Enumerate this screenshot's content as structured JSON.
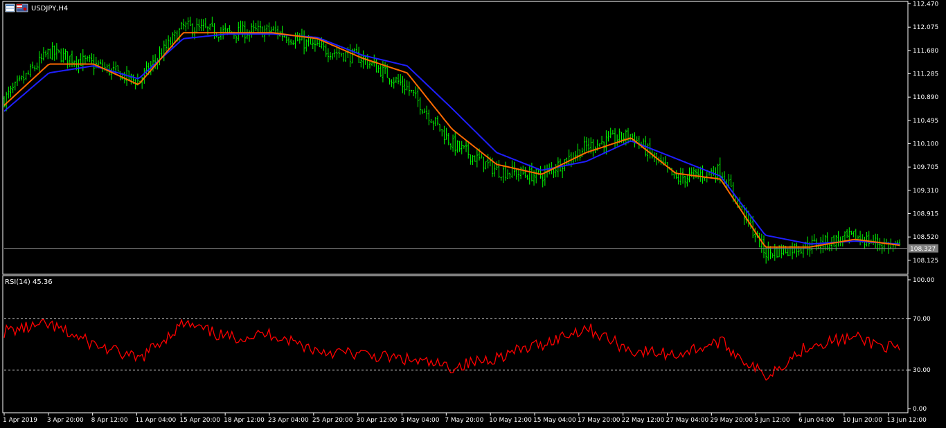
{
  "window": {
    "title": "USDJPY,H4",
    "icons": [
      "chart-window-icon",
      "us-japan-flag-icon"
    ]
  },
  "colors": {
    "background": "#000000",
    "frame": "#ffffff",
    "candle_up": "#00ff00",
    "ma_fast": "#ff6a00",
    "ma_slow": "#1f1fff",
    "rsi": "#ff0000",
    "price_line": "#808080",
    "price_label_bg": "#808080"
  },
  "price_axis": {
    "ticks": [
      "112.470",
      "112.075",
      "111.680",
      "111.285",
      "110.890",
      "110.495",
      "110.100",
      "109.705",
      "109.310",
      "108.915",
      "108.520",
      "108.125"
    ],
    "current_price": "108.327"
  },
  "rsi_axis": {
    "label": "RSI(14) 45.36",
    "ticks": [
      "100.00",
      "70.00",
      "30.00",
      "0.00"
    ],
    "levels": [
      70,
      30
    ]
  },
  "time_axis": {
    "labels": [
      "1 Apr 2019",
      "3 Apr 20:00",
      "8 Apr 12:00",
      "11 Apr 04:00",
      "15 Apr 20:00",
      "18 Apr 12:00",
      "23 Apr 04:00",
      "25 Apr 20:00",
      "30 Apr 12:00",
      "3 May 04:00",
      "7 May 20:00",
      "10 May 12:00",
      "15 May 04:00",
      "17 May 20:00",
      "22 May 12:00",
      "27 May 04:00",
      "29 May 20:00",
      "3 Jun 12:00",
      "6 Jun 04:00",
      "10 Jun 20:00",
      "13 Jun 12:00"
    ]
  },
  "chart_data": [
    {
      "type": "line",
      "series_kind": "candlestick-approximation",
      "symbol": "USDJPY",
      "timeframe": "H4",
      "ylim": [
        107.9,
        112.5
      ],
      "x": [
        "1 Apr 2019",
        "3 Apr 20:00",
        "8 Apr 12:00",
        "11 Apr 04:00",
        "15 Apr 20:00",
        "18 Apr 12:00",
        "23 Apr 04:00",
        "25 Apr 20:00",
        "30 Apr 12:00",
        "3 May 04:00",
        "7 May 20:00",
        "10 May 12:00",
        "15 May 04:00",
        "17 May 20:00",
        "22 May 12:00",
        "27 May 04:00",
        "29 May 20:00",
        "3 Jun 12:00",
        "6 Jun 04:00",
        "10 Jun 20:00",
        "13 Jun 12:00"
      ],
      "series": [
        {
          "name": "",
          "values": [
            110.85,
            111.65,
            111.45,
            111.15,
            112.08,
            111.98,
            112.02,
            111.72,
            111.55,
            111.05,
            110.1,
            109.65,
            109.55,
            110.05,
            110.25,
            109.5,
            109.65,
            108.25,
            108.38,
            108.52,
            108.33
          ]
        },
        {
          "name": "",
          "values": [
            110.75,
            111.45,
            111.45,
            111.1,
            111.98,
            111.98,
            111.98,
            111.88,
            111.55,
            111.3,
            110.35,
            109.75,
            109.58,
            109.95,
            110.2,
            109.6,
            109.5,
            108.35,
            108.35,
            108.48,
            108.38
          ]
        },
        {
          "name": "",
          "values": [
            110.65,
            111.3,
            111.42,
            111.2,
            111.88,
            111.96,
            111.96,
            111.9,
            111.6,
            111.42,
            110.7,
            109.95,
            109.65,
            109.8,
            110.15,
            109.85,
            109.55,
            108.55,
            108.4,
            108.45,
            108.4
          ]
        }
      ]
    },
    {
      "type": "line",
      "title": "RSI(14) 45.36",
      "ylim": [
        0,
        100
      ],
      "levels": [
        70,
        30
      ],
      "x": [
        "1 Apr 2019",
        "3 Apr 20:00",
        "8 Apr 12:00",
        "11 Apr 04:00",
        "15 Apr 20:00",
        "18 Apr 12:00",
        "23 Apr 04:00",
        "25 Apr 20:00",
        "30 Apr 12:00",
        "3 May 04:00",
        "7 May 20:00",
        "10 May 12:00",
        "15 May 04:00",
        "17 May 20:00",
        "22 May 12:00",
        "27 May 04:00",
        "29 May 20:00",
        "3 Jun 12:00",
        "6 Jun 04:00",
        "10 Jun 20:00",
        "13 Jun 12:00"
      ],
      "series": [
        {
          "name": "",
          "values": [
            60,
            65,
            50,
            38,
            66,
            55,
            58,
            45,
            42,
            38,
            32,
            40,
            50,
            63,
            45,
            42,
            52,
            25,
            50,
            55,
            45.36
          ]
        }
      ]
    }
  ]
}
